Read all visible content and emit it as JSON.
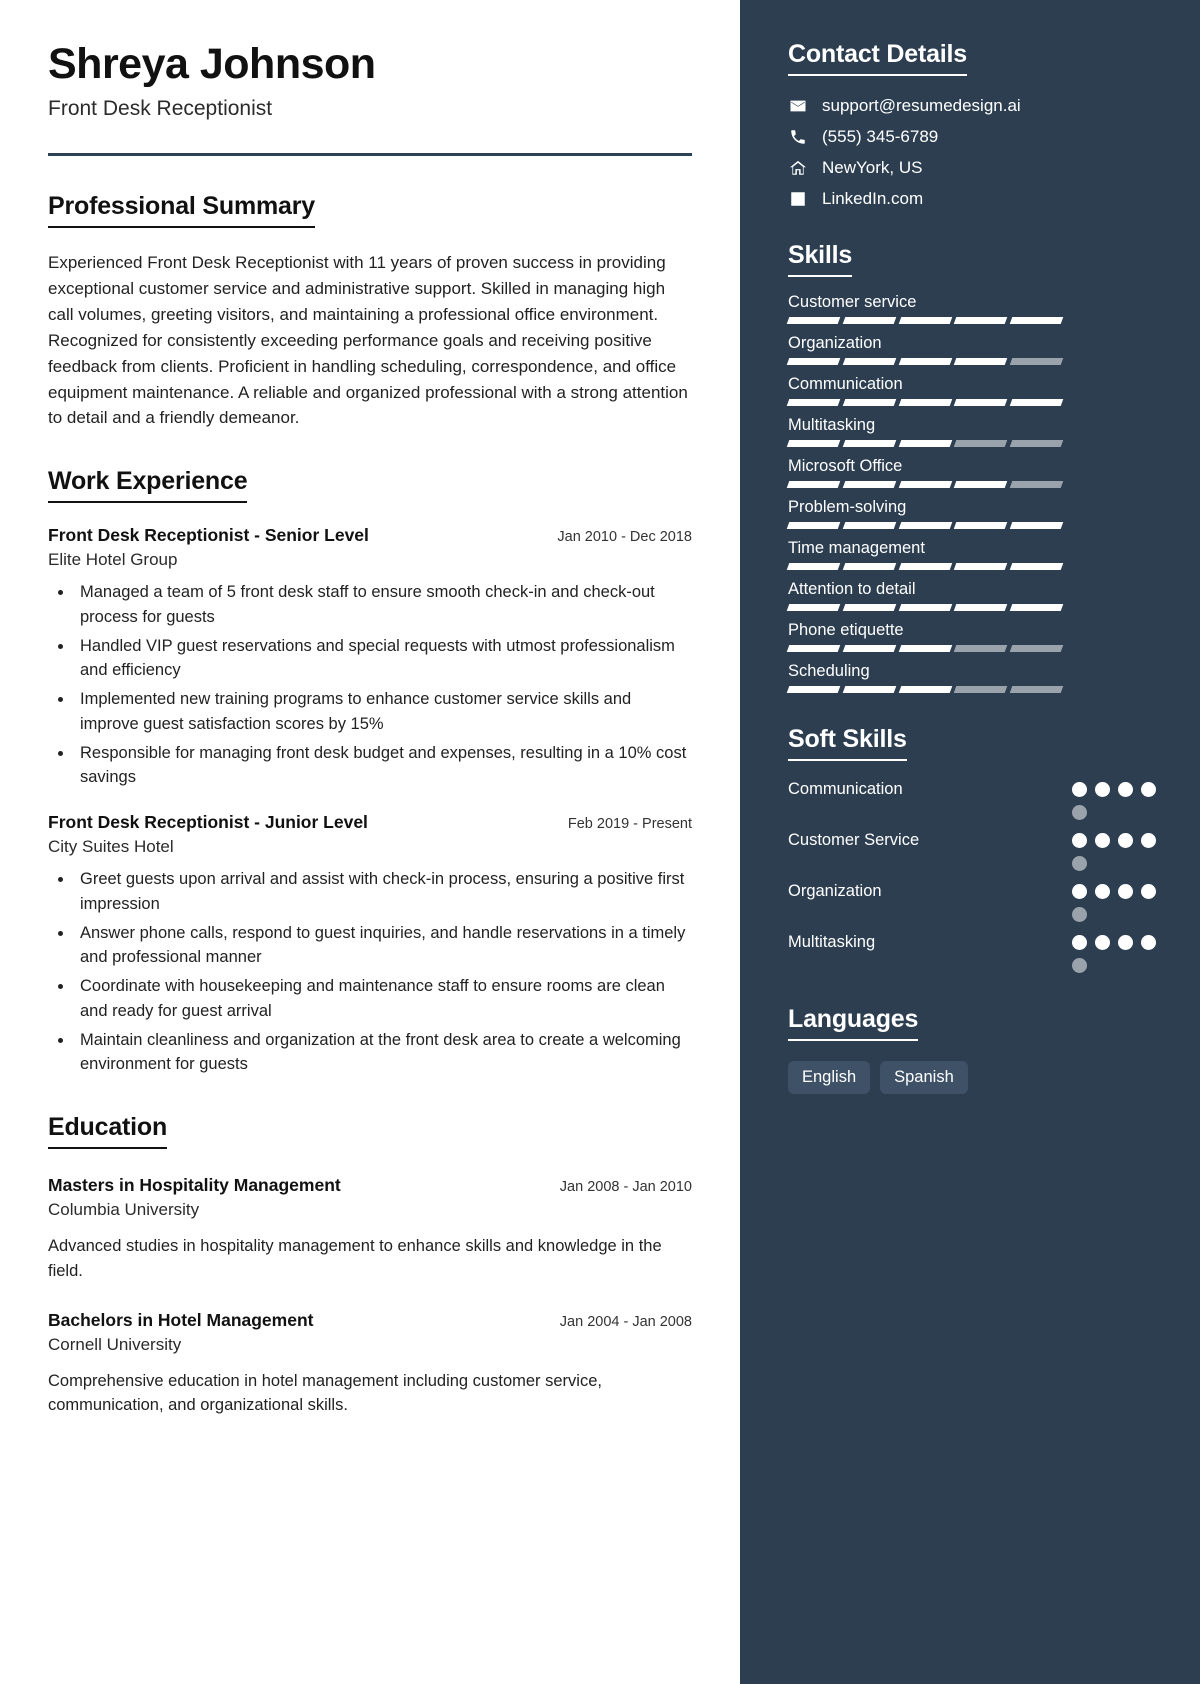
{
  "colors": {
    "sidebar_bg": "#2c3e50",
    "accent_rule": "#2e4257",
    "bar_on": "#ffffff",
    "bar_off": "#9aa3ab",
    "tag_bg": "#3e5166"
  },
  "header": {
    "name": "Shreya Johnson",
    "job_title": "Front Desk Receptionist"
  },
  "summary": {
    "title": "Professional Summary",
    "text": "Experienced Front Desk Receptionist with 11 years of proven success in providing exceptional customer service and administrative support. Skilled in managing high call volumes, greeting visitors, and maintaining a professional office environment. Recognized for consistently exceeding performance goals and receiving positive feedback from clients. Proficient in handling scheduling, correspondence, and office equipment maintenance. A reliable and organized professional with a strong attention to detail and a friendly demeanor."
  },
  "work": {
    "title": "Work Experience",
    "entries": [
      {
        "title": "Front Desk Receptionist - Senior Level",
        "date": "Jan 2010 - Dec 2018",
        "org": "Elite Hotel Group",
        "bullets": [
          "Managed a team of 5 front desk staff to ensure smooth check-in and check-out process for guests",
          "Handled VIP guest reservations and special requests with utmost professionalism and efficiency",
          "Implemented new training programs to enhance customer service skills and improve guest satisfaction scores by 15%",
          "Responsible for managing front desk budget and expenses, resulting in a 10% cost savings"
        ]
      },
      {
        "title": "Front Desk Receptionist - Junior Level",
        "date": "Feb 2019 - Present",
        "org": "City Suites Hotel",
        "bullets": [
          "Greet guests upon arrival and assist with check-in process, ensuring a positive first impression",
          "Answer phone calls, respond to guest inquiries, and handle reservations in a timely and professional manner",
          "Coordinate with housekeeping and maintenance staff to ensure rooms are clean and ready for guest arrival",
          "Maintain cleanliness and organization at the front desk area to create a welcoming environment for guests"
        ]
      }
    ]
  },
  "education": {
    "title": "Education",
    "entries": [
      {
        "title": "Masters in Hospitality Management",
        "date": "Jan 2008 - Jan 2010",
        "org": "Columbia University",
        "desc": "Advanced studies in hospitality management to enhance skills and knowledge in the field."
      },
      {
        "title": "Bachelors in Hotel Management",
        "date": "Jan 2004 - Jan 2008",
        "org": "Cornell University",
        "desc": "Comprehensive education in hotel management including customer service, communication, and organizational skills."
      }
    ]
  },
  "contact": {
    "title": "Contact Details",
    "items": [
      {
        "icon": "envelope-icon",
        "value": "support@resumedesign.ai"
      },
      {
        "icon": "phone-icon",
        "value": "(555) 345-6789"
      },
      {
        "icon": "home-icon",
        "value": "NewYork, US"
      },
      {
        "icon": "linkedin-icon",
        "value": "LinkedIn.com"
      }
    ]
  },
  "skills": {
    "title": "Skills",
    "max_segments": 5,
    "items": [
      {
        "name": "Customer service",
        "level": 5
      },
      {
        "name": "Organization",
        "level": 4
      },
      {
        "name": "Communication",
        "level": 5
      },
      {
        "name": "Multitasking",
        "level": 3
      },
      {
        "name": "Microsoft Office",
        "level": 4
      },
      {
        "name": "Problem-solving",
        "level": 5
      },
      {
        "name": "Time management",
        "level": 5
      },
      {
        "name": "Attention to detail",
        "level": 5
      },
      {
        "name": "Phone etiquette",
        "level": 3
      },
      {
        "name": "Scheduling",
        "level": 3
      }
    ]
  },
  "soft_skills": {
    "title": "Soft Skills",
    "max_dots": 5,
    "items": [
      {
        "name": "Communication",
        "level": 4
      },
      {
        "name": "Customer Service",
        "level": 4
      },
      {
        "name": "Organization",
        "level": 4
      },
      {
        "name": "Multitasking",
        "level": 4
      }
    ]
  },
  "languages": {
    "title": "Languages",
    "items": [
      "English",
      "Spanish"
    ]
  }
}
